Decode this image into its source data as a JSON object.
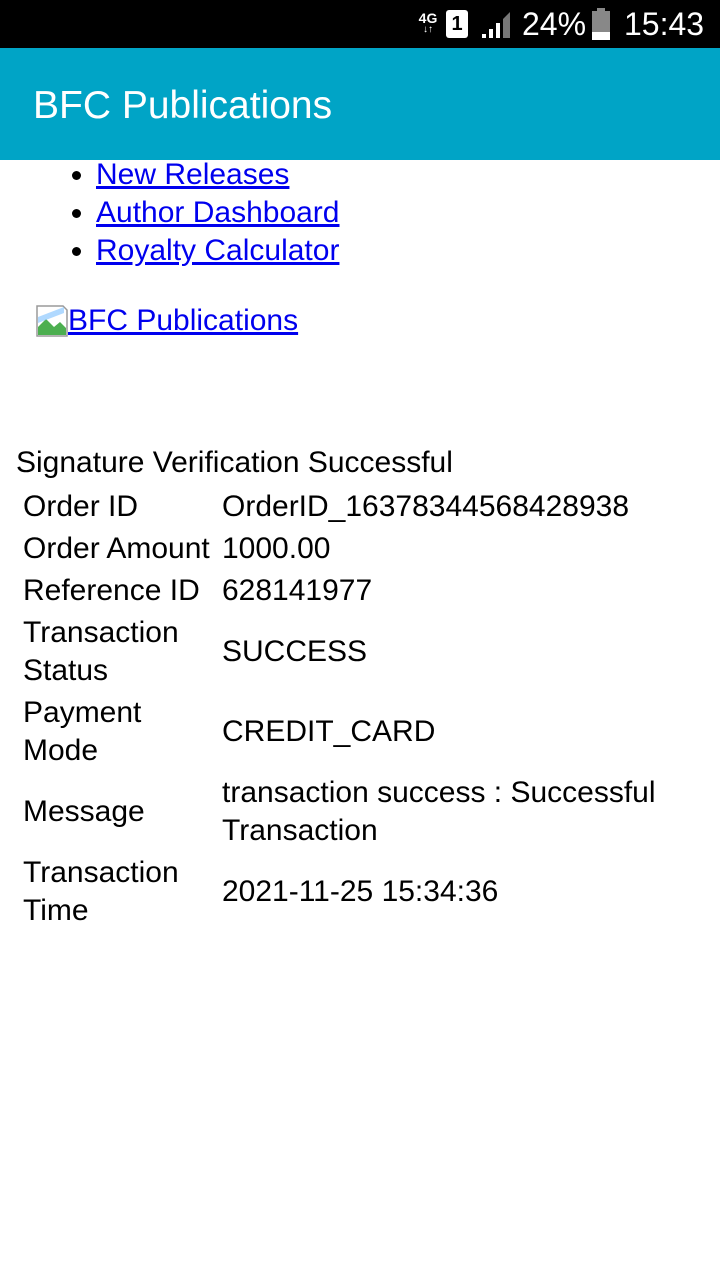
{
  "status_bar": {
    "network_type": "4G",
    "network_arrows": "↓↑",
    "sim_slot": "1",
    "battery_percent": "24%",
    "time": "15:43"
  },
  "app_bar": {
    "title": "BFC Publications"
  },
  "nav": {
    "items": [
      {
        "label": "New Releases"
      },
      {
        "label": "Author Dashboard"
      },
      {
        "label": "Royalty Calculator"
      }
    ]
  },
  "logo": {
    "alt_text": "BFC Publications"
  },
  "result": {
    "message": "Signature Verification Successful",
    "rows": [
      {
        "key": "Order ID",
        "value": "OrderID_16378344568428938"
      },
      {
        "key": "Order Amount",
        "value": "1000.00"
      },
      {
        "key": "Reference ID",
        "value": "628141977"
      },
      {
        "key": "Transaction Status",
        "value": "SUCCESS"
      },
      {
        "key": "Payment Mode",
        "value": "CREDIT_CARD"
      },
      {
        "key": "Message",
        "value": "transaction success : Successful Transaction"
      },
      {
        "key": "Transaction Time",
        "value": "2021-11-25 15:34:36"
      }
    ]
  }
}
